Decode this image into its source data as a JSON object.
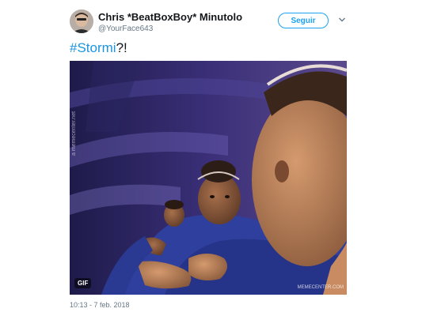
{
  "user": {
    "display_name": "Chris *BeatBoxBoy* Minutolo",
    "handle": "@YourFace643",
    "avatar_icon": "avatar"
  },
  "header": {
    "follow_label": "Seguir",
    "menu_icon": "chevron-down-icon"
  },
  "tweet": {
    "hashtag": "#Stormi",
    "suffix": "?!"
  },
  "media": {
    "badge": "GIF",
    "watermark_right": "MEMECENTER.COM",
    "watermark_left": "a memecenter.net"
  },
  "footer": {
    "timestamp": "10:13 - 7 feb. 2018"
  },
  "colors": {
    "accent": "#1da1f2",
    "hashtag": "#1b95e0",
    "name": "#14171a",
    "meta": "#657786"
  }
}
